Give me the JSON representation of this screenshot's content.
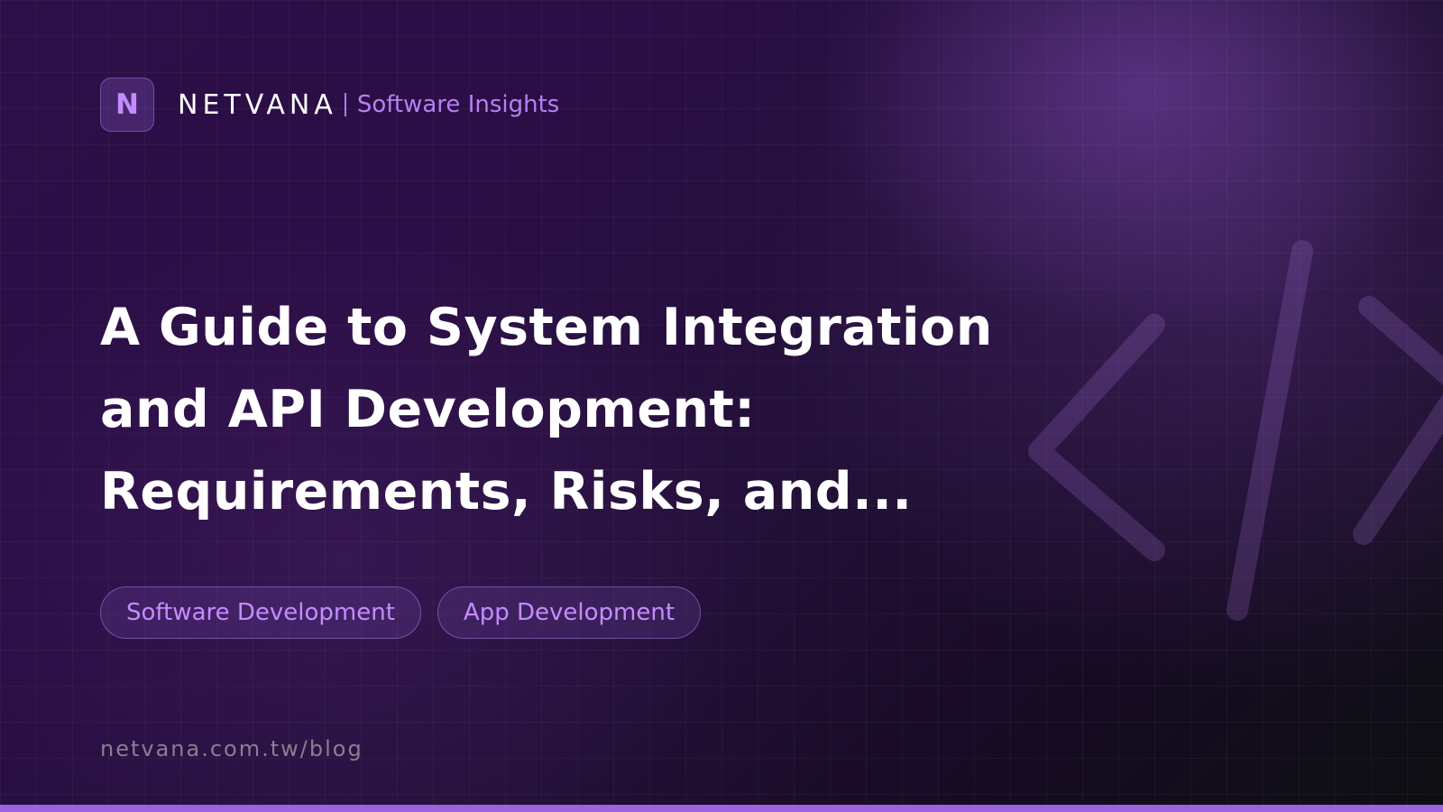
{
  "brand": {
    "logo_letter": "N",
    "name": "NETVANA",
    "tagline": "Software Insights"
  },
  "headline": {
    "line1": "A Guide to System Integration",
    "line2": "and API Development:",
    "line3": "Requirements, Risks, and..."
  },
  "tags": [
    {
      "label": "Software Development"
    },
    {
      "label": "App Development"
    }
  ],
  "footer": {
    "url": "netvana.com.tw/blog"
  },
  "decoration": {
    "icon": "code-brackets-icon"
  },
  "colors": {
    "accent": "#b681f0",
    "bottom_bar": "#9b63e0",
    "background_start": "#2d0f48",
    "background_end": "#0d0f12"
  }
}
